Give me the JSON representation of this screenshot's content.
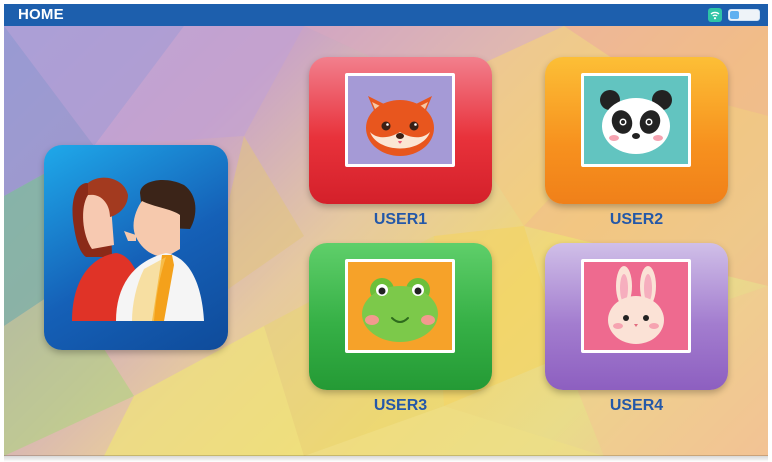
{
  "statusbar": {
    "title": "HOME"
  },
  "users": [
    {
      "label": "USER1",
      "avatar": "fox"
    },
    {
      "label": "USER2",
      "avatar": "panda"
    },
    {
      "label": "USER3",
      "avatar": "frog"
    },
    {
      "label": "USER4",
      "avatar": "rabbit"
    }
  ],
  "colors": {
    "statusbar": "#1d5fad",
    "label_text": "#2458a8",
    "user1_tile": "#e8323b",
    "user2_tile": "#f7911e",
    "user3_tile": "#36b046",
    "user4_tile": "#a37dcf",
    "main_tile": "#1560b7"
  }
}
